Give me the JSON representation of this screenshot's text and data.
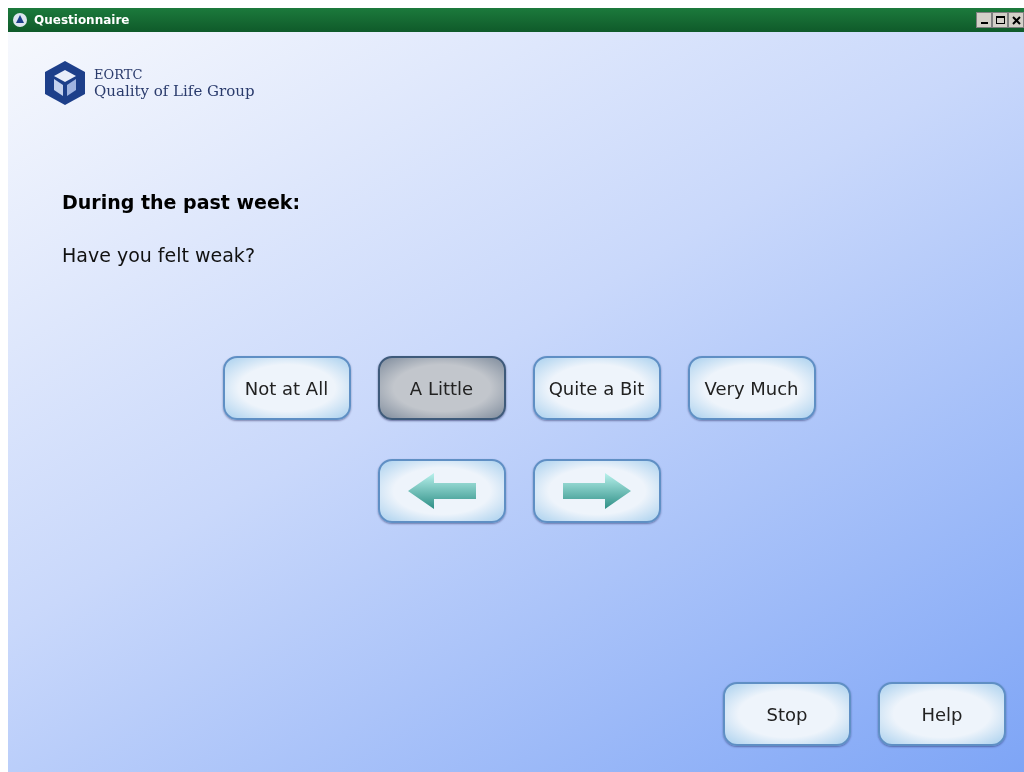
{
  "window": {
    "title": "Questionnaire"
  },
  "logo": {
    "line1": "EORTC",
    "line2": "Quality of Life Group"
  },
  "heading": "During the past week:",
  "question": "Have you felt weak?",
  "answers": [
    {
      "label": "Not at All",
      "selected": false
    },
    {
      "label": "A Little",
      "selected": true
    },
    {
      "label": "Quite a Bit",
      "selected": false
    },
    {
      "label": "Very Much",
      "selected": false
    }
  ],
  "navigation": [
    {
      "kind": "back"
    },
    {
      "kind": "next"
    }
  ],
  "footer_buttons": [
    "Stop",
    "Help"
  ]
}
